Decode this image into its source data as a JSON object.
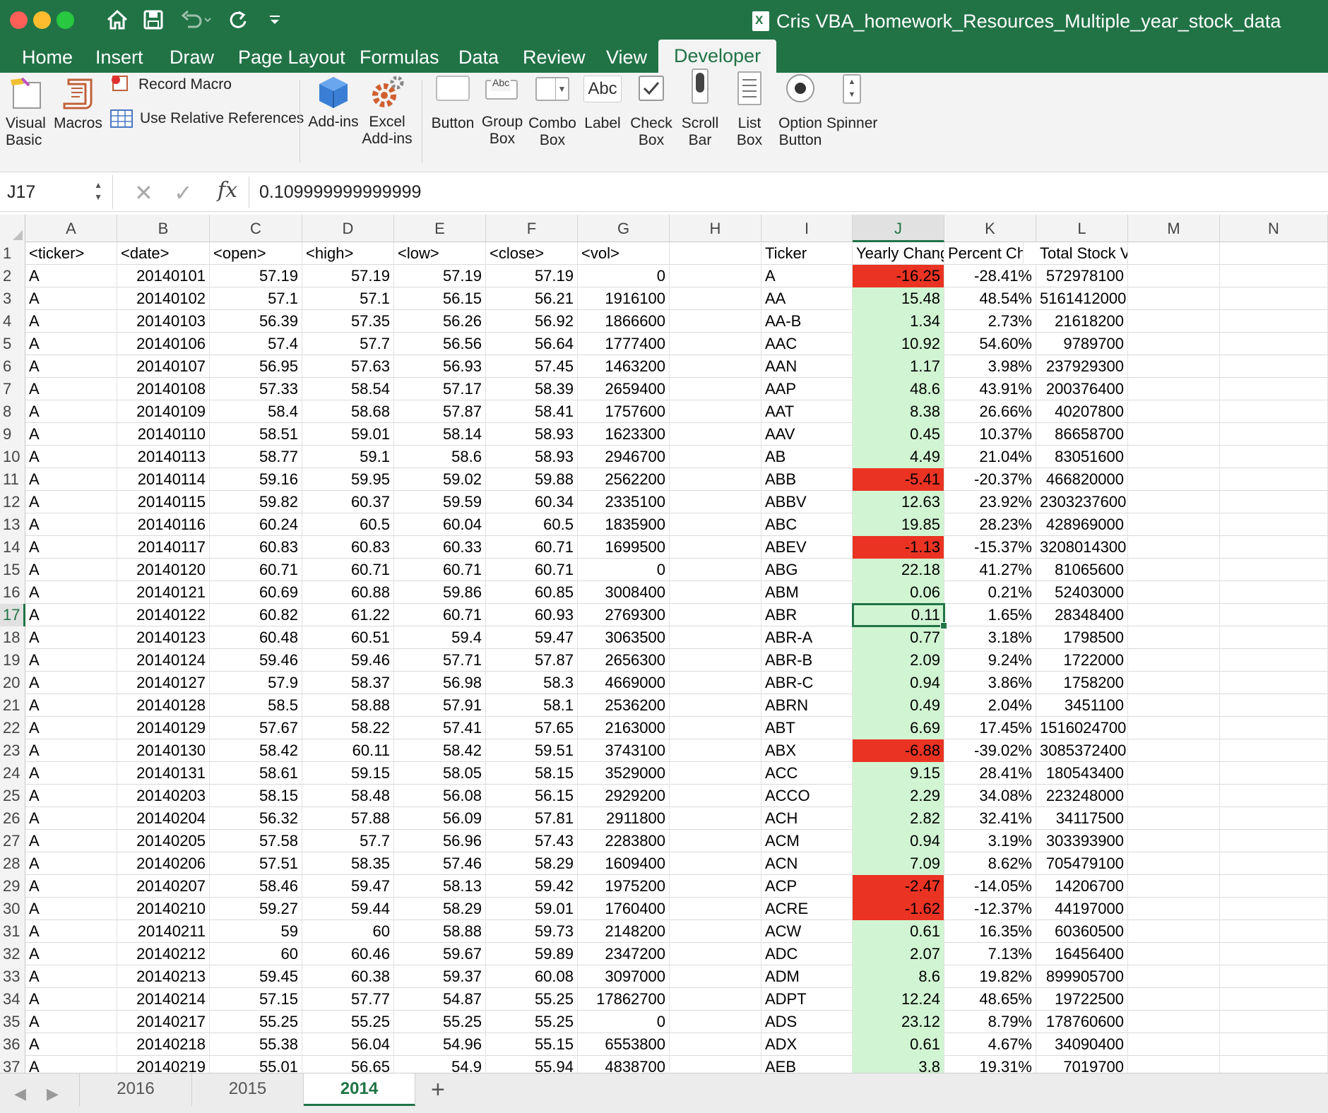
{
  "window": {
    "title": "Cris VBA_homework_Resources_Multiple_year_stock_data"
  },
  "tabs": [
    "Home",
    "Insert",
    "Draw",
    "Page Layout",
    "Formulas",
    "Data",
    "Review",
    "View",
    "Developer"
  ],
  "active_tab": "Developer",
  "ribbon": {
    "visual_basic": "Visual\nBasic",
    "macros": "Macros",
    "record_macro": "Record Macro",
    "use_relative": "Use Relative References",
    "addins": "Add-ins",
    "excel_addins": "Excel\nAdd-ins",
    "button": "Button",
    "group_box": "Group\nBox",
    "combo_box": "Combo\nBox",
    "label": "Label",
    "check_box": "Check\nBox",
    "scroll_bar": "Scroll\nBar",
    "list_box": "List\nBox",
    "option_button": "Option\nButton",
    "spinner": "Spinner",
    "label_icon_text": "Abc",
    "group_icon_text": "Abc"
  },
  "formula_bar": {
    "name_box": "J17",
    "fx": "fx",
    "value": "0.109999999999999"
  },
  "columns": [
    "A",
    "B",
    "C",
    "D",
    "E",
    "F",
    "G",
    "H",
    "I",
    "J",
    "K",
    "L",
    "M",
    "N"
  ],
  "selected_column": "J",
  "selected_row": 17,
  "header_row": [
    "<ticker>",
    "<date>",
    "<open>",
    "<high>",
    "<low>",
    "<close>",
    "<vol>",
    "",
    "Ticker",
    "Yearly Change",
    "Percent Change",
    "Total Stock Volume"
  ],
  "rows": [
    [
      "A",
      "20140101",
      "57.19",
      "57.19",
      "57.19",
      "57.19",
      "0",
      "",
      "A",
      "-16.25",
      "-28.41%",
      "572978100"
    ],
    [
      "A",
      "20140102",
      "57.1",
      "57.1",
      "56.15",
      "56.21",
      "1916100",
      "",
      "AA",
      "15.48",
      "48.54%",
      "5161412000"
    ],
    [
      "A",
      "20140103",
      "56.39",
      "57.35",
      "56.26",
      "56.92",
      "1866600",
      "",
      "AA-B",
      "1.34",
      "2.73%",
      "21618200"
    ],
    [
      "A",
      "20140106",
      "57.4",
      "57.7",
      "56.56",
      "56.64",
      "1777400",
      "",
      "AAC",
      "10.92",
      "54.60%",
      "9789700"
    ],
    [
      "A",
      "20140107",
      "56.95",
      "57.63",
      "56.93",
      "57.45",
      "1463200",
      "",
      "AAN",
      "1.17",
      "3.98%",
      "237929300"
    ],
    [
      "A",
      "20140108",
      "57.33",
      "58.54",
      "57.17",
      "58.39",
      "2659400",
      "",
      "AAP",
      "48.6",
      "43.91%",
      "200376400"
    ],
    [
      "A",
      "20140109",
      "58.4",
      "58.68",
      "57.87",
      "58.41",
      "1757600",
      "",
      "AAT",
      "8.38",
      "26.66%",
      "40207800"
    ],
    [
      "A",
      "20140110",
      "58.51",
      "59.01",
      "58.14",
      "58.93",
      "1623300",
      "",
      "AAV",
      "0.45",
      "10.37%",
      "86658700"
    ],
    [
      "A",
      "20140113",
      "58.77",
      "59.1",
      "58.6",
      "58.93",
      "2946700",
      "",
      "AB",
      "4.49",
      "21.04%",
      "83051600"
    ],
    [
      "A",
      "20140114",
      "59.16",
      "59.95",
      "59.02",
      "59.88",
      "2562200",
      "",
      "ABB",
      "-5.41",
      "-20.37%",
      "466820000"
    ],
    [
      "A",
      "20140115",
      "59.82",
      "60.37",
      "59.59",
      "60.34",
      "2335100",
      "",
      "ABBV",
      "12.63",
      "23.92%",
      "2303237600"
    ],
    [
      "A",
      "20140116",
      "60.24",
      "60.5",
      "60.04",
      "60.5",
      "1835900",
      "",
      "ABC",
      "19.85",
      "28.23%",
      "428969000"
    ],
    [
      "A",
      "20140117",
      "60.83",
      "60.83",
      "60.33",
      "60.71",
      "1699500",
      "",
      "ABEV",
      "-1.13",
      "-15.37%",
      "3208014300"
    ],
    [
      "A",
      "20140120",
      "60.71",
      "60.71",
      "60.71",
      "60.71",
      "0",
      "",
      "ABG",
      "22.18",
      "41.27%",
      "81065600"
    ],
    [
      "A",
      "20140121",
      "60.69",
      "60.88",
      "59.86",
      "60.85",
      "3008400",
      "",
      "ABM",
      "0.06",
      "0.21%",
      "52403000"
    ],
    [
      "A",
      "20140122",
      "60.82",
      "61.22",
      "60.71",
      "60.93",
      "2769300",
      "",
      "ABR",
      "0.11",
      "1.65%",
      "28348400"
    ],
    [
      "A",
      "20140123",
      "60.48",
      "60.51",
      "59.4",
      "59.47",
      "3063500",
      "",
      "ABR-A",
      "0.77",
      "3.18%",
      "1798500"
    ],
    [
      "A",
      "20140124",
      "59.46",
      "59.46",
      "57.71",
      "57.87",
      "2656300",
      "",
      "ABR-B",
      "2.09",
      "9.24%",
      "1722000"
    ],
    [
      "A",
      "20140127",
      "57.9",
      "58.37",
      "56.98",
      "58.3",
      "4669000",
      "",
      "ABR-C",
      "0.94",
      "3.86%",
      "1758200"
    ],
    [
      "A",
      "20140128",
      "58.5",
      "58.88",
      "57.91",
      "58.1",
      "2536200",
      "",
      "ABRN",
      "0.49",
      "2.04%",
      "3451100"
    ],
    [
      "A",
      "20140129",
      "57.67",
      "58.22",
      "57.41",
      "57.65",
      "2163000",
      "",
      "ABT",
      "6.69",
      "17.45%",
      "1516024700"
    ],
    [
      "A",
      "20140130",
      "58.42",
      "60.11",
      "58.42",
      "59.51",
      "3743100",
      "",
      "ABX",
      "-6.88",
      "-39.02%",
      "3085372400"
    ],
    [
      "A",
      "20140131",
      "58.61",
      "59.15",
      "58.05",
      "58.15",
      "3529000",
      "",
      "ACC",
      "9.15",
      "28.41%",
      "180543400"
    ],
    [
      "A",
      "20140203",
      "58.15",
      "58.48",
      "56.08",
      "56.15",
      "2929200",
      "",
      "ACCO",
      "2.29",
      "34.08%",
      "223248000"
    ],
    [
      "A",
      "20140204",
      "56.32",
      "57.88",
      "56.09",
      "57.81",
      "2911800",
      "",
      "ACH",
      "2.82",
      "32.41%",
      "34117500"
    ],
    [
      "A",
      "20140205",
      "57.58",
      "57.7",
      "56.96",
      "57.43",
      "2283800",
      "",
      "ACM",
      "0.94",
      "3.19%",
      "303393900"
    ],
    [
      "A",
      "20140206",
      "57.51",
      "58.35",
      "57.46",
      "58.29",
      "1609400",
      "",
      "ACN",
      "7.09",
      "8.62%",
      "705479100"
    ],
    [
      "A",
      "20140207",
      "58.46",
      "59.47",
      "58.13",
      "59.42",
      "1975200",
      "",
      "ACP",
      "-2.47",
      "-14.05%",
      "14206700"
    ],
    [
      "A",
      "20140210",
      "59.27",
      "59.44",
      "58.29",
      "59.01",
      "1760400",
      "",
      "ACRE",
      "-1.62",
      "-12.37%",
      "44197000"
    ],
    [
      "A",
      "20140211",
      "59",
      "60",
      "58.88",
      "59.73",
      "2148200",
      "",
      "ACW",
      "0.61",
      "16.35%",
      "60360500"
    ],
    [
      "A",
      "20140212",
      "60",
      "60.46",
      "59.67",
      "59.89",
      "2347200",
      "",
      "ADC",
      "2.07",
      "7.13%",
      "16456400"
    ],
    [
      "A",
      "20140213",
      "59.45",
      "60.38",
      "59.37",
      "60.08",
      "3097000",
      "",
      "ADM",
      "8.6",
      "19.82%",
      "899905700"
    ],
    [
      "A",
      "20140214",
      "57.15",
      "57.77",
      "54.87",
      "55.25",
      "17862700",
      "",
      "ADPT",
      "12.24",
      "48.65%",
      "19722500"
    ],
    [
      "A",
      "20140217",
      "55.25",
      "55.25",
      "55.25",
      "55.25",
      "0",
      "",
      "ADS",
      "23.12",
      "8.79%",
      "178760600"
    ],
    [
      "A",
      "20140218",
      "55.38",
      "56.04",
      "54.96",
      "55.15",
      "6553800",
      "",
      "ADX",
      "0.61",
      "4.67%",
      "34090400"
    ],
    [
      "A",
      "20140219",
      "55.01",
      "56.65",
      "54.9",
      "55.94",
      "4838700",
      "",
      "AEB",
      "3.8",
      "19.31%",
      "7019700"
    ]
  ],
  "colors": {
    "excel_green": "#217346",
    "negative_fill": "#ea3323",
    "positive_fill": "#d1f5d3"
  },
  "sheets": [
    "2016",
    "2015",
    "2014"
  ],
  "active_sheet": "2014",
  "icons": [
    "home-icon",
    "save-icon",
    "undo-icon",
    "redo-icon",
    "customize-icon"
  ]
}
